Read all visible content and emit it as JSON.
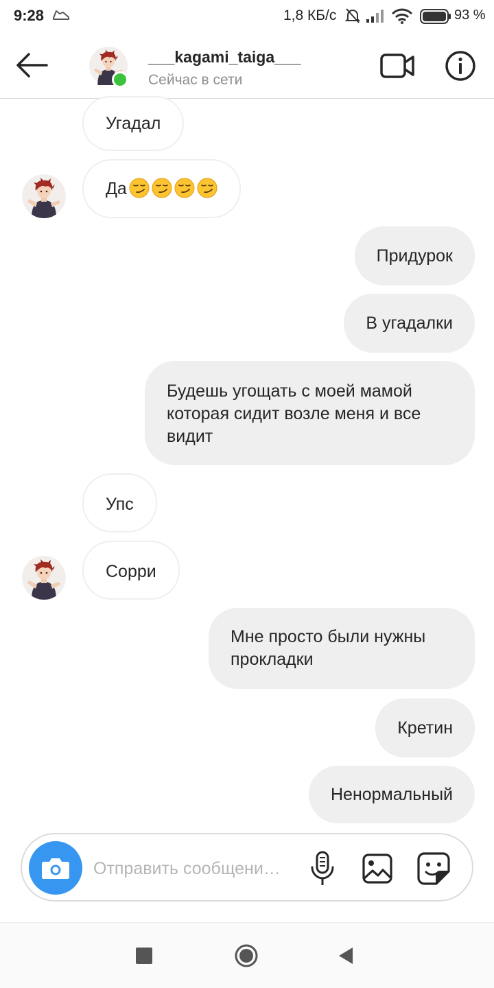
{
  "status_bar": {
    "time": "9:28",
    "network_speed": "1,8 КБ/с",
    "battery": "93 %"
  },
  "header": {
    "username": "___kagami_taiga___",
    "presence": "Сейчас в сети"
  },
  "messages": [
    {
      "side": "in",
      "text": "Угадал"
    },
    {
      "side": "in",
      "text": "Да",
      "emoji_count": 4,
      "emoji": "smirking-face"
    },
    {
      "side": "out",
      "text": "Придурок"
    },
    {
      "side": "out",
      "text": "В угадалки"
    },
    {
      "side": "out",
      "lines": [
        "Будешь угощать с моей мамой",
        "которая сидит возле меня и все",
        "видит"
      ]
    },
    {
      "side": "in",
      "text": "Упс"
    },
    {
      "side": "in",
      "text": "Сорри"
    },
    {
      "side": "out",
      "lines": [
        "Мне просто были нужны",
        "прокладки"
      ]
    },
    {
      "side": "out",
      "text": "Кретин"
    },
    {
      "side": "out",
      "text": "Ненормальный"
    }
  ],
  "composer": {
    "placeholder": "Отправить сообщени…",
    "value": ""
  },
  "colors": {
    "accent": "#3797f0",
    "online": "#3dc23d",
    "outgoing_bubble": "#efefef",
    "muted_text": "#8e8e8e"
  },
  "icons": [
    "back-arrow-icon",
    "video-call-icon",
    "info-icon",
    "camera-icon",
    "microphone-icon",
    "gallery-icon",
    "sticker-icon"
  ]
}
